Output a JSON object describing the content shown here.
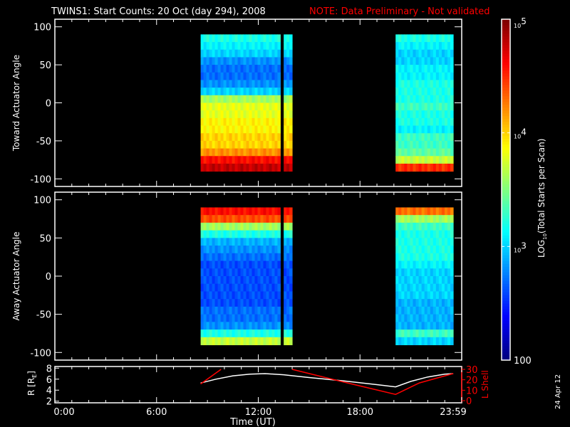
{
  "title": "TWINS1: Start Counts: 20 Oct (day 294), 2008",
  "note": "NOTE: Data Preliminary - Not validated",
  "side_date": "24 Apr 12",
  "chart_data": [
    {
      "type": "heatmap",
      "name": "toward",
      "ylabel": "Toward Actuator Angle",
      "ylim": [
        -110,
        110
      ],
      "yticks": [
        "100",
        "50",
        "0",
        "-50",
        "-100"
      ],
      "ytick_values": [
        100,
        50,
        0,
        -50,
        -100
      ],
      "angle_bins": [
        90,
        80,
        70,
        60,
        50,
        40,
        30,
        20,
        10,
        0,
        -10,
        -20,
        -30,
        -40,
        -50,
        -60,
        -70,
        -80
      ],
      "segments": [
        {
          "start_h": 8.6,
          "end_h": 13.3,
          "log_counts": [
            3.2,
            3.1,
            3.0,
            2.8,
            2.7,
            2.7,
            2.8,
            3.0,
            3.6,
            3.8,
            3.8,
            3.9,
            3.9,
            4.0,
            4.0,
            4.2,
            4.6,
            4.8
          ]
        },
        {
          "start_h": 13.5,
          "end_h": 14.0,
          "log_counts": [
            3.2,
            3.1,
            3.0,
            2.8,
            2.7,
            2.7,
            2.8,
            3.0,
            3.6,
            3.8,
            3.8,
            3.9,
            3.9,
            4.0,
            4.0,
            4.2,
            4.6,
            4.8
          ]
        },
        {
          "start_h": 20.1,
          "end_h": 23.5,
          "log_counts": [
            3.2,
            3.1,
            3.0,
            3.0,
            3.1,
            3.1,
            3.2,
            3.2,
            3.2,
            3.3,
            3.2,
            3.2,
            3.1,
            3.3,
            3.3,
            3.4,
            3.7,
            4.5
          ]
        }
      ]
    },
    {
      "type": "heatmap",
      "name": "away",
      "ylabel": "Away Actuator Angle",
      "ylim": [
        -110,
        110
      ],
      "yticks": [
        "100",
        "50",
        "0",
        "-50",
        "-100"
      ],
      "ytick_values": [
        100,
        50,
        0,
        -50,
        -100
      ],
      "angle_bins": [
        90,
        80,
        70,
        60,
        50,
        40,
        30,
        20,
        10,
        0,
        -10,
        -20,
        -30,
        -40,
        -50,
        -60,
        -70,
        -80
      ],
      "segments": [
        {
          "start_h": 8.6,
          "end_h": 13.3,
          "log_counts": [
            4.6,
            4.4,
            3.6,
            3.2,
            2.9,
            2.8,
            2.7,
            2.6,
            2.6,
            2.6,
            2.6,
            2.6,
            2.6,
            2.7,
            2.7,
            2.8,
            3.2,
            3.7
          ]
        },
        {
          "start_h": 13.5,
          "end_h": 14.0,
          "log_counts": [
            4.6,
            4.4,
            3.6,
            3.2,
            2.9,
            2.8,
            2.7,
            2.6,
            2.6,
            2.6,
            2.6,
            2.6,
            2.6,
            2.7,
            2.7,
            2.8,
            3.2,
            3.7
          ]
        },
        {
          "start_h": 20.1,
          "end_h": 23.5,
          "log_counts": [
            4.3,
            3.6,
            3.3,
            3.2,
            3.2,
            3.2,
            3.2,
            3.1,
            3.0,
            3.0,
            3.0,
            3.0,
            2.9,
            2.9,
            2.9,
            2.9,
            3.3,
            3.0
          ]
        }
      ]
    },
    {
      "type": "line",
      "name": "orbit",
      "ylabel": "R [R",
      "ylabel_sub": "E",
      "ylabel_end": "]",
      "ylim": [
        1.7,
        8.3
      ],
      "yticks": [
        "8",
        "6",
        "4",
        "2"
      ],
      "ytick_values": [
        8,
        6,
        4,
        2
      ],
      "y2label": "L Shell",
      "y2lim": [
        0,
        30
      ],
      "y2ticks": [
        "30",
        "20",
        "10",
        "0"
      ],
      "y2tick_values": [
        30,
        20,
        10,
        0
      ],
      "xlabel": "Time (UT)",
      "xlim": [
        0,
        24
      ],
      "xticks": [
        "0:00",
        "6:00",
        "12:00",
        "18:00",
        "23:59"
      ],
      "xtick_values": [
        0,
        6,
        12,
        18,
        24
      ],
      "series": [
        {
          "name": "R",
          "color": "#ffffff",
          "x": [
            8.6,
            9.5,
            10.5,
            11.5,
            12.4,
            13.5,
            15,
            17,
            19,
            20.1,
            21,
            22,
            23,
            23.5
          ],
          "y": [
            5.3,
            6.0,
            6.6,
            6.9,
            7.0,
            6.8,
            6.3,
            5.7,
            5.0,
            4.6,
            5.6,
            6.4,
            6.9,
            7.0
          ]
        },
        {
          "name": "L Shell",
          "color": "#ff0000",
          "axis": "right",
          "x": [
            8.6,
            9.8,
            null,
            14.0,
            17,
            20.1,
            21.5,
            23.5
          ],
          "y": [
            16,
            30,
            null,
            30,
            18,
            6,
            17,
            26
          ]
        }
      ]
    }
  ],
  "colorbar": {
    "label": "LOG",
    "label_sub": "10",
    "label_rest": "(Total Starts per Scan)",
    "range_log": [
      2,
      5
    ],
    "ticks": [
      {
        "base": "10",
        "exp": "5",
        "value": 5
      },
      {
        "base": "10",
        "exp": "4",
        "value": 4
      },
      {
        "base": "10",
        "exp": "3",
        "value": 3
      },
      {
        "base": "100",
        "exp": "",
        "value": 2
      }
    ]
  }
}
